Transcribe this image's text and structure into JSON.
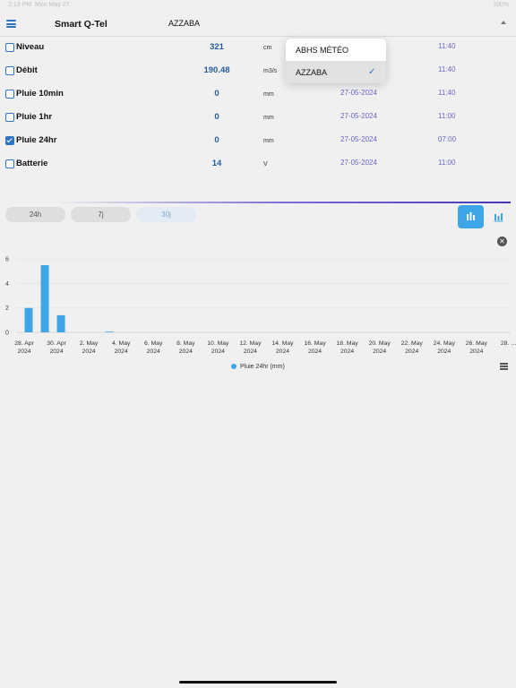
{
  "status_bar": {
    "time": "2:13 PM",
    "date": "Mon May 27",
    "right": "100%"
  },
  "header": {
    "title": "Smart Q-Tel",
    "station": "AZZABA"
  },
  "dropdown": {
    "items": [
      {
        "label": "ABHS MÉTÉO"
      },
      {
        "label": "AZZABA",
        "selected": true
      }
    ]
  },
  "sensors": [
    {
      "name": "Niveau",
      "value": "321",
      "unit": "cm",
      "date": "",
      "time": "11:40",
      "checked": false
    },
    {
      "name": "Débit",
      "value": "190.48",
      "unit": "m3/s",
      "date": "",
      "time": "11:40",
      "checked": false
    },
    {
      "name": "Pluie 10min",
      "value": "0",
      "unit": "mm",
      "date": "27-05-2024",
      "time": "11:40",
      "checked": false
    },
    {
      "name": "Pluie 1hr",
      "value": "0",
      "unit": "mm",
      "date": "27-05-2024",
      "time": "11:00",
      "checked": false
    },
    {
      "name": "Pluie 24hr",
      "value": "0",
      "unit": "mm",
      "date": "27-05-2024",
      "time": "07:00",
      "checked": true
    },
    {
      "name": "Batterie",
      "value": "14",
      "unit": "V",
      "date": "27-05-2024",
      "time": "11:00",
      "checked": false
    }
  ],
  "periods": {
    "p24h": "24h",
    "p7j": "7j",
    "p30j": "30j",
    "active": "30j"
  },
  "icons": {
    "menu": "hamburger-icon",
    "collapse": "caret-up-icon",
    "bar_chart": "bar-chart-icon",
    "stacked_chart": "stacked-chart-icon",
    "close": "close-icon",
    "chart_menu": "hamburger-icon",
    "check": "checkmark-icon"
  },
  "colors": {
    "accent": "#2f74c0",
    "bar": "#3da6e6",
    "date_text": "#6a67c4",
    "value_text": "#2a5d9c"
  },
  "chart_data": {
    "type": "bar",
    "series": [
      {
        "name": "Pluie 24hr (mm)",
        "color": "#3da6e6",
        "values": [
          2,
          5.5,
          1.4,
          0,
          0,
          0.05,
          0,
          0,
          0,
          0,
          0,
          0,
          0,
          0,
          0,
          0,
          0,
          0,
          0,
          0,
          0,
          0,
          0,
          0,
          0,
          0,
          0,
          0,
          0,
          0,
          0
        ]
      }
    ],
    "categories": [
      "28 Apr",
      "29 Apr",
      "30 Apr",
      "1 May",
      "2 May",
      "3 May",
      "4 May",
      "5 May",
      "6 May",
      "7 May",
      "8 May",
      "9 May",
      "10 May",
      "11 May",
      "12 May",
      "13 May",
      "14 May",
      "15 May",
      "16 May",
      "17 May",
      "18 May",
      "19 May",
      "20 May",
      "21 May",
      "22 May",
      "23 May",
      "24 May",
      "25 May",
      "26 May",
      "27 May",
      "28 May"
    ],
    "x_tick_labels": [
      {
        "day": "28. Apr",
        "year": "2024"
      },
      {
        "day": "30. Apr",
        "year": "2024"
      },
      {
        "day": "2. May",
        "year": "2024"
      },
      {
        "day": "4. May",
        "year": "2024"
      },
      {
        "day": "6. May",
        "year": "2024"
      },
      {
        "day": "8. May",
        "year": "2024"
      },
      {
        "day": "10. May",
        "year": "2024"
      },
      {
        "day": "12. May",
        "year": "2024"
      },
      {
        "day": "14. May",
        "year": "2024"
      },
      {
        "day": "16. May",
        "year": "2024"
      },
      {
        "day": "18. May",
        "year": "2024"
      },
      {
        "day": "20. May",
        "year": "2024"
      },
      {
        "day": "22. May",
        "year": "2024"
      },
      {
        "day": "24. May",
        "year": "2024"
      },
      {
        "day": "26. May",
        "year": "2024"
      },
      {
        "day": "28. …",
        "year": ""
      }
    ],
    "y_ticks": [
      0,
      2,
      4,
      6
    ],
    "ylim": [
      0,
      6.6
    ],
    "grid": true,
    "legend_position": "bottom-center",
    "legend": "Pluie 24hr (mm)"
  }
}
